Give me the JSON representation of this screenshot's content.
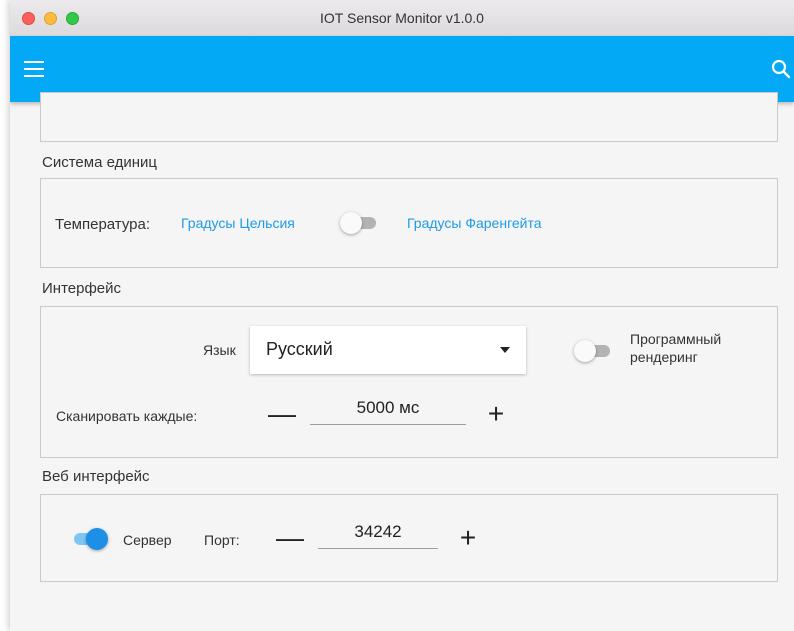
{
  "window": {
    "title": "IOT Sensor Monitor v1.0.0"
  },
  "appbar": {
    "color": "#03a9f4",
    "menu_icon": "hamburger-menu-icon",
    "search_icon": "search-icon"
  },
  "units": {
    "section_title": "Система единиц",
    "temperature_label": "Температура:",
    "celsius_label": "Градусы Цельсия",
    "fahrenheit_label": "Градусы Фаренгейта",
    "fahrenheit_enabled": false
  },
  "interface": {
    "section_title": "Интерфейс",
    "language_label": "Язык",
    "language_value": "Русский",
    "software_rendering_label_line1": "Программный",
    "software_rendering_label_line2": "рендеринг",
    "software_rendering_enabled": false,
    "scan_label": "Сканировать каждые:",
    "scan_minus": "—",
    "scan_value": "5000 мс",
    "scan_plus": "+"
  },
  "web": {
    "section_title": "Веб интерфейс",
    "server_label": "Сервер",
    "server_enabled": true,
    "port_label": "Порт:",
    "port_minus": "—",
    "port_value": "34242",
    "port_plus": "+"
  },
  "colors": {
    "accent": "#1e9be6",
    "link": "#1e9be6"
  }
}
